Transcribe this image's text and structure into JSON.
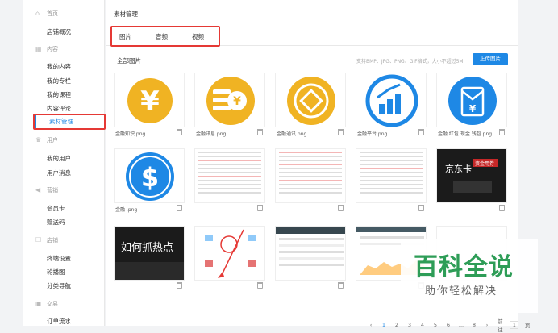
{
  "sidebar": {
    "groups": [
      {
        "icon": "home-icon",
        "label": "首页",
        "items": [
          "店铺概况"
        ]
      },
      {
        "icon": "grid-icon",
        "label": "内容",
        "items": [
          "我的内容",
          "我的专栏",
          "我的课程",
          "内容评论",
          "素材管理"
        ]
      },
      {
        "icon": "crown-icon",
        "label": "用户",
        "items": [
          "我的用户",
          "用户消息"
        ]
      },
      {
        "icon": "megaphone-icon",
        "label": "营销",
        "items": [
          "会员卡",
          "赠送码"
        ]
      },
      {
        "icon": "store-icon",
        "label": "店铺",
        "items": [
          "终端设置",
          "轮播图",
          "分类导航"
        ]
      },
      {
        "icon": "ledger-icon",
        "label": "交易",
        "items": [
          "订单流水"
        ]
      }
    ],
    "active_item": "素材管理"
  },
  "main": {
    "title": "素材管理",
    "tabs": [
      "图片",
      "音频",
      "视频"
    ],
    "section_title": "全部图片",
    "hint": "支持BMP、JPG、PNG、GIF格式，大小不超过5M",
    "upload_label": "上传图片"
  },
  "images": [
    {
      "name": "金融知识.png",
      "icon": "yen-coin-icon"
    },
    {
      "name": "金融讯息.png",
      "icon": "yen-coins-icon"
    },
    {
      "name": "金融通讯.png",
      "icon": "diamond-coin-icon"
    },
    {
      "name": "金融平台.png",
      "icon": "finance-chart-icon"
    },
    {
      "name": "金融 红包 现金 钱包.png",
      "icon": "red-envelope-icon"
    },
    {
      "name": "金融 .png",
      "icon": "dollar-coin-icon"
    },
    {
      "name": "",
      "icon": "article-screenshot-icon"
    },
    {
      "name": "",
      "icon": "article-screenshot-icon"
    },
    {
      "name": "",
      "icon": "article-screenshot-icon"
    },
    {
      "name": "",
      "icon": "jd-banner-icon"
    },
    {
      "name": "",
      "icon": "hot-banner-icon"
    },
    {
      "name": "",
      "icon": "app-screenshot-icon"
    },
    {
      "name": "",
      "icon": "table-screenshot-icon"
    },
    {
      "name": "",
      "icon": "chart-screenshot-icon"
    },
    {
      "name": "",
      "icon": "blank-icon"
    }
  ],
  "banner_text": {
    "jd": "京东卡",
    "jd_sub": "资金用券",
    "hot": "如何抓热点"
  },
  "pager": {
    "pages": [
      "1",
      "2",
      "3",
      "4",
      "5",
      "6",
      "...",
      "8"
    ],
    "goto_label": "前往",
    "current": "1",
    "page_unit": "页"
  },
  "watermark": {
    "big": "百科全说",
    "small": "助你轻松解决"
  },
  "colors": {
    "accent": "#1e88e5",
    "coin_yellow": "#f0b323",
    "coin_blue": "#1e88e5",
    "highlight_red": "#e53935",
    "watermark_green": "#2e9d57"
  }
}
